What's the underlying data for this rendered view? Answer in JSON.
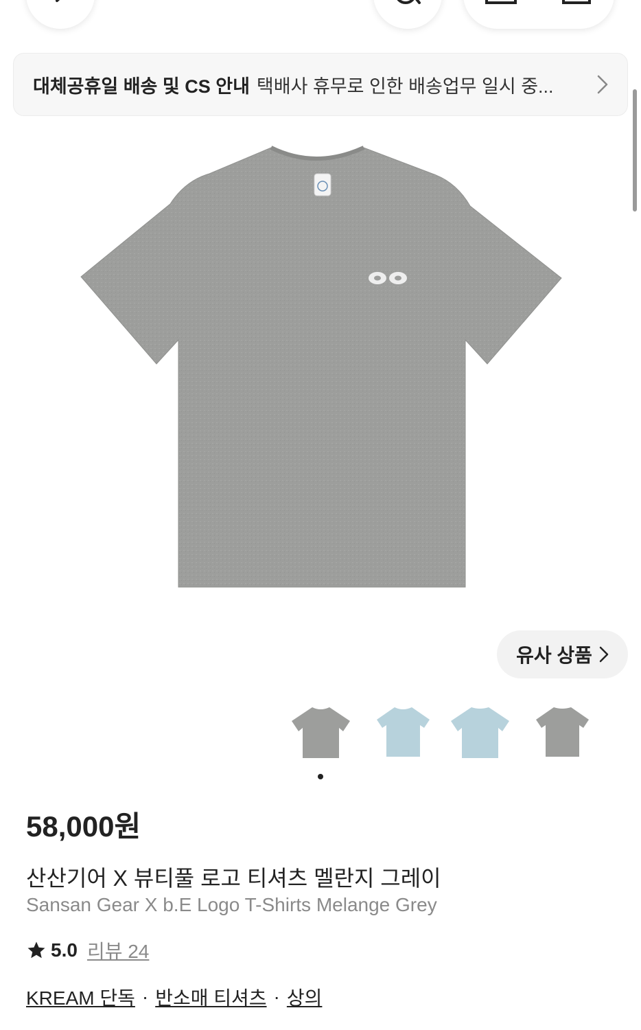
{
  "nav": {
    "back_icon": "chevron-left-icon",
    "search_icon": "search-icon",
    "share_icon": "share-icon",
    "bookmark_icon": "bookmark-icon"
  },
  "notice": {
    "title": "대체공휴일 배송 및 CS 안내",
    "text": "택배사 휴무로 인한 배송업무 일시 중..."
  },
  "similar": {
    "label": "유사 상품"
  },
  "product": {
    "price": "58,000원",
    "name_ko": "산산기어 X 뷰티풀 로고 티셔츠 멜란지 그레이",
    "name_en": "Sansan Gear X b.E Logo T-Shirts Melange Grey",
    "rating": "5.0",
    "review_label": "리뷰 24",
    "categories": [
      "KREAM 단독",
      "반소매 티셔츠",
      "상의"
    ],
    "separator": "·"
  },
  "colors": {
    "tshirt_grey": "#9d9e9c",
    "tshirt_blue": "#b7d2dc",
    "chip_bg": "#f2f2f2"
  }
}
